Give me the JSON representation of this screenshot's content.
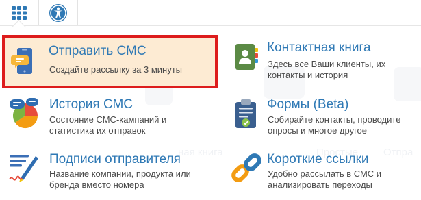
{
  "topbar": {
    "apps_icon": "grid-apps-icon",
    "accessibility_icon": "accessibility-icon"
  },
  "menu": {
    "items": [
      {
        "title": "Отправить СМС",
        "desc": "Создайте рассылку за 3 минуты",
        "icon": "sms-phone-icon",
        "active": true
      },
      {
        "title": "Контактная книга",
        "desc": "Здесь все Ваши клиенты, их контакты и история",
        "icon": "contact-book-icon"
      },
      {
        "title": "История СМС",
        "desc": "Состояние СМС-кампаний и статистика их отправок",
        "icon": "sms-history-pie-icon"
      },
      {
        "title": "Формы (Beta)",
        "desc": "Собирайте контакты, проводите опросы и многое другое",
        "icon": "forms-clipboard-icon"
      },
      {
        "title": "Подписи отправителя",
        "desc": "Название компании, продукта или бренда вместо номера",
        "icon": "sender-signature-icon"
      },
      {
        "title": "Короткие ссылки",
        "desc": "Удобно рассылать в СМС и анализировать переходы",
        "icon": "short-links-chain-icon"
      }
    ]
  },
  "background": {
    "ghost_1": "ная книга",
    "ghost_2": "Простые",
    "ghost_3": "Отпра"
  },
  "colors": {
    "accent": "#2f79b5",
    "active_bg": "#fdebd3",
    "active_border": "#dd1c1c"
  }
}
